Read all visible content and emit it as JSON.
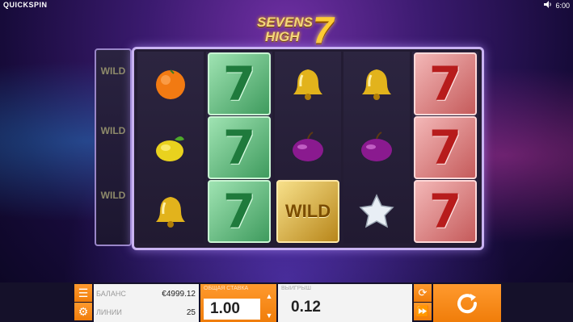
{
  "brand": "QUICKSPIN",
  "top_right": {
    "volume_icon": "speaker-icon",
    "time": "6:00"
  },
  "logo": {
    "line1": "SEVENS",
    "line2": "HIGH",
    "seven": "7"
  },
  "side_reel": [
    {
      "symbol": "wild",
      "label": "WILD"
    },
    {
      "symbol": "wild",
      "label": "WILD"
    },
    {
      "symbol": "wild",
      "label": "WILD"
    }
  ],
  "reels": [
    [
      "orange",
      "lemon",
      "bell"
    ],
    [
      "seven-green",
      "seven-green",
      "seven-green"
    ],
    [
      "bell",
      "plum",
      "wild-gold"
    ],
    [
      "bell",
      "plum",
      "star"
    ],
    [
      "seven-red",
      "seven-red",
      "seven-red"
    ]
  ],
  "symbols": {
    "seven": "7",
    "wild": "WILD"
  },
  "bottom": {
    "balance_label": "БАЛАНС",
    "balance_value": "€4999.12",
    "lines_label": "ЛИНИИ",
    "lines_value": "25",
    "bet_label": "ОБЩАЯ СТАВКА",
    "bet_value": "1.00",
    "win_label": "ВЫИГРЫШ",
    "win_value": "0.12"
  },
  "colors": {
    "accent": "#f07d0a",
    "frame": "#c9b3f2"
  }
}
